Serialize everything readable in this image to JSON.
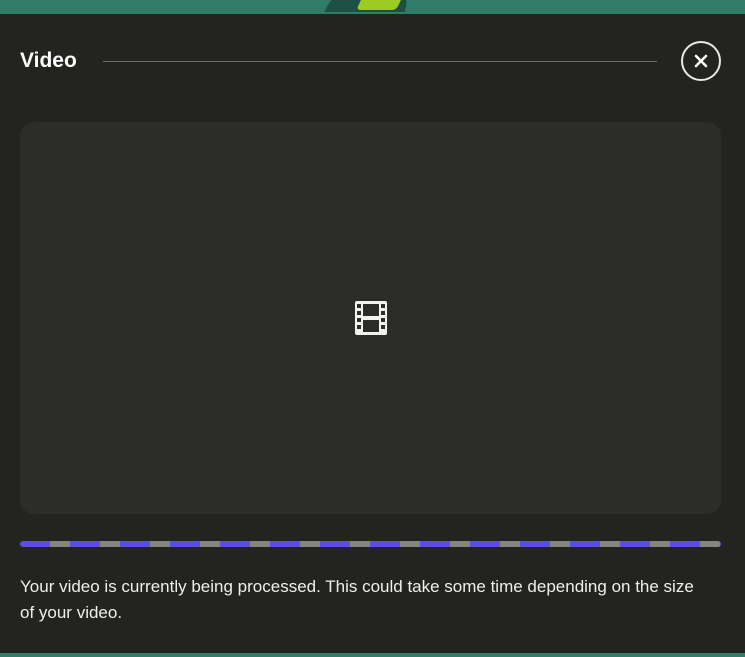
{
  "modal": {
    "title": "Video",
    "close_icon": "close-icon",
    "player_icon": "film-icon",
    "processing_progress": 0.5,
    "message": "Your video is currently being processed. This could take some time depending on the size of your video."
  },
  "colors": {
    "modal_background": "#232320",
    "player_background": "#2c2c29",
    "progress_accent": "#5a4ee2",
    "progress_track": "#858580",
    "backdrop": "#327b69"
  }
}
